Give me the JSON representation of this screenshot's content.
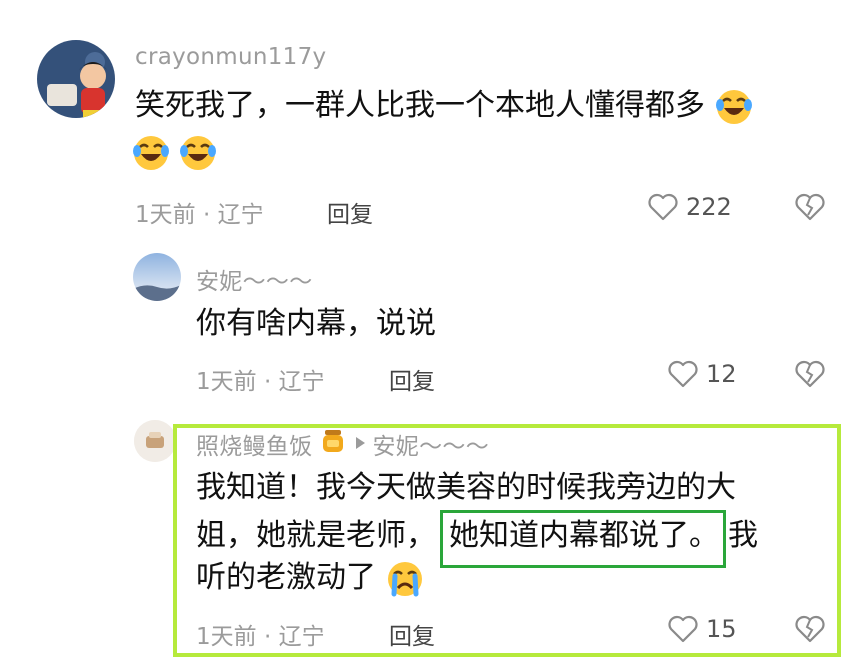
{
  "comment1": {
    "username": "crayonmun117y",
    "text": "笑死我了，一群人比我一个本地人懂得都多",
    "time_location": "1天前 · 辽宁",
    "reply_label": "回复",
    "likes": "222",
    "emoji": "laughing-crying-emoji"
  },
  "reply1": {
    "username": "安妮～～～",
    "text": "你有啥内幕，说说",
    "time_location": "1天前 · 辽宁",
    "reply_label": "回复",
    "likes": "12"
  },
  "reply2": {
    "username": "照烧鳗鱼饭",
    "reply_to": "安妮～～～",
    "text_line1": "我知道！我今天做美容的时候我旁边的大",
    "text_line2a": "姐，她就是老师，",
    "text_highlight": "她知道内幕都说了。",
    "text_line2b": "我",
    "text_line3": "听的老激动了",
    "time_location": "1天前 · 辽宁",
    "reply_label": "回复",
    "likes": "15",
    "emoji": "crying-emoji"
  },
  "colors": {
    "outer_highlight": "#b6ea3c",
    "inner_highlight": "#2aa63a",
    "meta_gray": "#9b9b9b"
  }
}
